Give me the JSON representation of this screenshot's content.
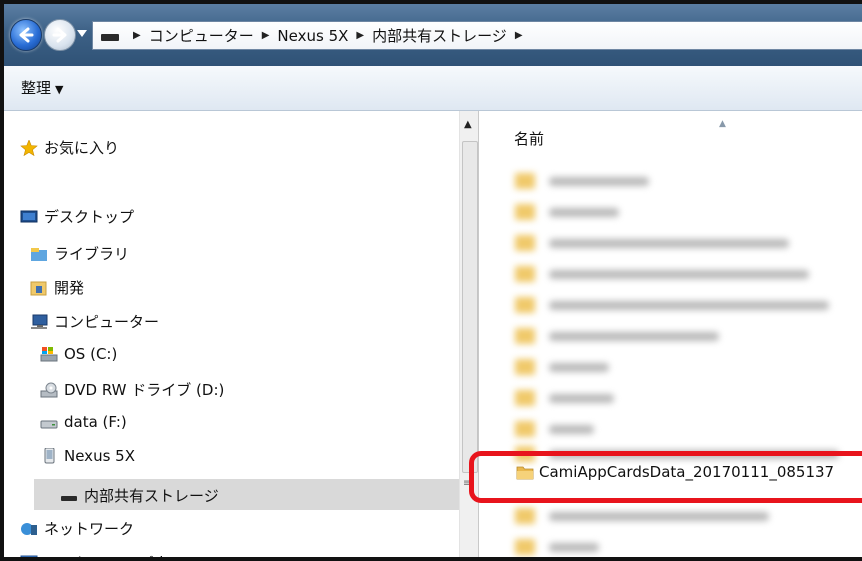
{
  "address_bar": {
    "breadcrumbs": [
      "コンピューター",
      "Nexus 5X",
      "内部共有ストレージ"
    ]
  },
  "toolbar": {
    "organize_label": "整理"
  },
  "nav": {
    "favorites": "お気に入り",
    "desktop": "デスクトップ",
    "library": "ライブラリ",
    "dev": "開発",
    "computer": "コンピューター",
    "drive_c": "OS (C:)",
    "drive_d": "DVD RW ドライブ (D:)",
    "drive_f": "data (F:)",
    "nexus": "Nexus 5X",
    "internal_storage": "内部共有ストレージ",
    "network": "ネットワーク",
    "control_panel": "コントロール パネル"
  },
  "content": {
    "column_name": "名前",
    "highlighted_item": "CamiAppCardsData_20170111_085137"
  },
  "colors": {
    "highlight_border": "#e8141c",
    "folder": "#f0c96a",
    "selection": "#d9d9d9"
  }
}
